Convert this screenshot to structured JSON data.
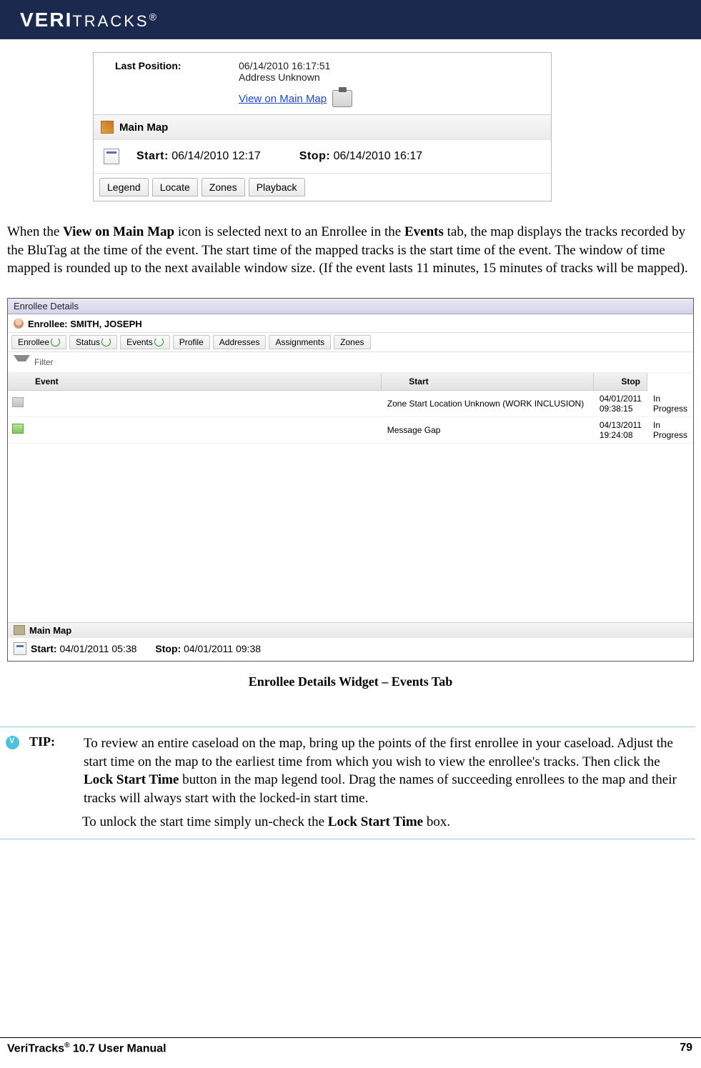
{
  "header": {
    "logo_main": "VERI",
    "logo_rest": "TRACKS",
    "reg": "®"
  },
  "ss1": {
    "last_position_label": "Last Position:",
    "last_position_value1": "06/14/2010 16:17:51",
    "last_position_value2": "Address Unknown",
    "view_link": "View on Main Map",
    "main_map": "Main Map",
    "start_label": "Start:",
    "start_value": "06/14/2010 12:17",
    "stop_label": "Stop:",
    "stop_value": "06/14/2010 16:17",
    "tabs": [
      "Legend",
      "Locate",
      "Zones",
      "Playback"
    ]
  },
  "para1_parts": {
    "a": "When the ",
    "b": "View on Main Map",
    "c": " icon is selected next to an Enrollee in the ",
    "d": "Events",
    "e": " tab, the map displays the tracks recorded by the BluTag at the time of the event.  The start time of the mapped tracks is the start time of the event. The window of time mapped is rounded up to the next available window size.  (If the event lasts 11 minutes, 15 minutes of tracks will be mapped)."
  },
  "ss2": {
    "title": "Enrollee Details",
    "subtitle": "Enrollee: SMITH, JOSEPH",
    "tabs": [
      "Enrollee",
      "Status",
      "Events",
      "Profile",
      "Addresses",
      "Assignments",
      "Zones"
    ],
    "filter": "Filter",
    "columns": [
      "Event",
      "Start",
      "Stop"
    ],
    "rows": [
      {
        "event": "Zone Start Location Unknown (WORK INCLUSION)",
        "start": "04/01/2011 09:38:15",
        "stop": "In Progress",
        "iconClass": "row-icon"
      },
      {
        "event": "Message Gap",
        "start": "04/13/2011 19:24:08",
        "stop": "In Progress",
        "iconClass": "row-icon green"
      }
    ],
    "main_map": "Main Map",
    "start_label": "Start:",
    "start_value": "04/01/2011 05:38",
    "stop_label": "Stop:",
    "stop_value": "04/01/2011 09:38"
  },
  "caption": "Enrollee Details Widget – Events Tab",
  "tip": {
    "label": "TIP:",
    "p1a": "To review an entire caseload on the map, bring up the points of the first enrollee in your caseload. Adjust the start time on the map to the earliest time from which you wish to view the enrollee's tracks. Then click the ",
    "p1b": "Lock Start Time",
    "p1c": "  button in the map legend tool. Drag the names of succeeding enrollees to the map and their tracks will always start with the locked-in start time.",
    "p2a": "To unlock the start time simply un-check the ",
    "p2b": "Lock Start Time",
    "p2c": " box."
  },
  "footer": {
    "left_a": "VeriTracks",
    "left_reg": "®",
    "left_b": " 10.7 User Manual",
    "page": "79"
  }
}
